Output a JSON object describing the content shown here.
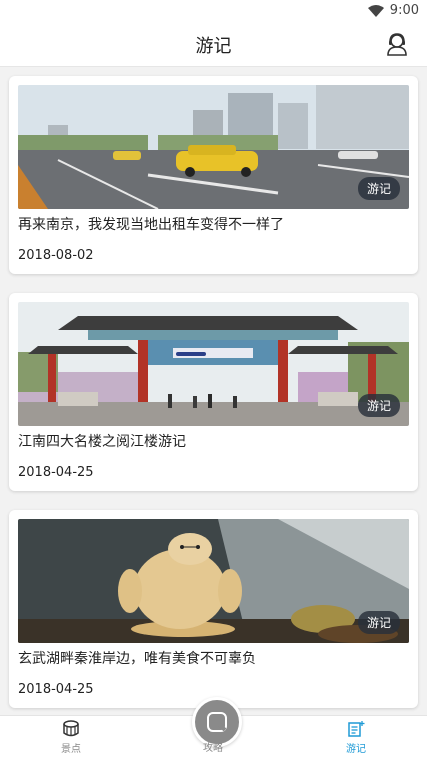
{
  "status_bar": {
    "time": "9:00"
  },
  "header": {
    "title": "游记"
  },
  "cards": [
    {
      "title": "再来南京，我发现当地出租车变得不一样了",
      "date": "2018-08-02",
      "tag": "游记",
      "image": "street-scene-with-taxi"
    },
    {
      "title": "江南四大名楼之阅江楼游记",
      "date": "2018-04-25",
      "tag": "游记",
      "image": "traditional-gate-archway"
    },
    {
      "title": "玄武湖畔秦淮岸边，唯有美食不可辜负",
      "date": "2018-04-25",
      "tag": "游记",
      "image": "pastry-figurine"
    }
  ],
  "bottom_nav": {
    "items": [
      {
        "label": "景点",
        "icon": "drum-icon"
      },
      {
        "label": "攻略",
        "icon": "center-circle-icon"
      },
      {
        "label": "游记",
        "icon": "notes-icon"
      }
    ],
    "active_color": "#1e9ad6"
  }
}
